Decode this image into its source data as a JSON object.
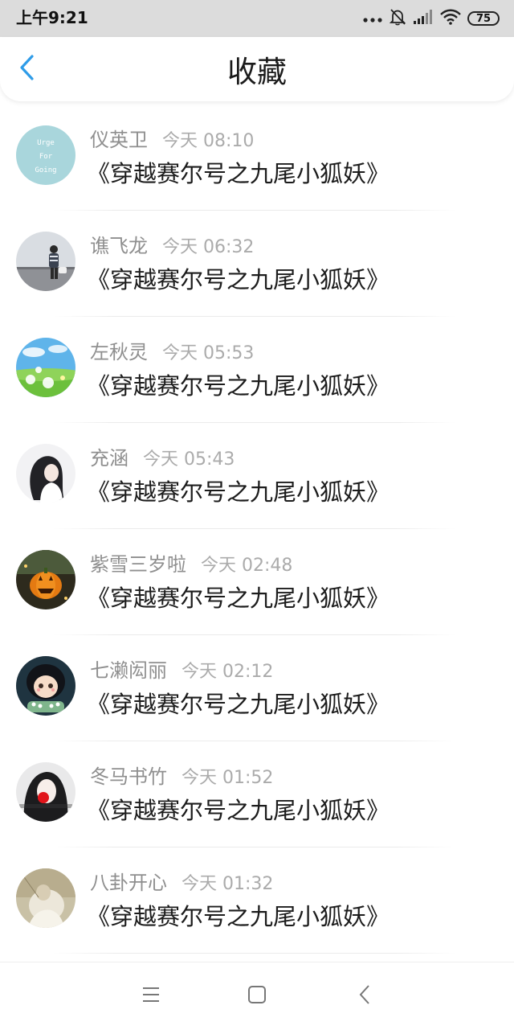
{
  "status_bar": {
    "time": "上午9:21",
    "icons": [
      "more-dots-icon",
      "mute-bell-icon",
      "signal-icon",
      "wifi-icon",
      "battery-icon"
    ],
    "battery": "75"
  },
  "header": {
    "title": "收藏",
    "back_icon": "chevron-left-icon",
    "accent": "#2f9ce8"
  },
  "items": [
    {
      "name": "仪英卫",
      "time": "今天 08:10",
      "message": "《穿越赛尔号之九尾小狐妖》",
      "avatar_text": [
        "Urge",
        "For",
        "Going"
      ]
    },
    {
      "name": "谯飞龙",
      "time": "今天 06:32",
      "message": "《穿越赛尔号之九尾小狐妖》"
    },
    {
      "name": "左秋灵",
      "time": "今天 05:53",
      "message": "《穿越赛尔号之九尾小狐妖》"
    },
    {
      "name": "充涵",
      "time": "今天 05:43",
      "message": "《穿越赛尔号之九尾小狐妖》"
    },
    {
      "name": "紫雪三岁啦",
      "time": "今天 02:48",
      "message": "《穿越赛尔号之九尾小狐妖》"
    },
    {
      "name": "七濑闳丽",
      "time": "今天 02:12",
      "message": "《穿越赛尔号之九尾小狐妖》"
    },
    {
      "name": "冬马书竹",
      "time": "今天 01:52",
      "message": "《穿越赛尔号之九尾小狐妖》"
    },
    {
      "name": "八卦开心",
      "time": "今天 01:32",
      "message": "《穿越赛尔号之九尾小狐妖》"
    }
  ],
  "nav_bar": {
    "icons": [
      "menu-icon",
      "home-square-icon",
      "back-triangle-icon"
    ]
  }
}
